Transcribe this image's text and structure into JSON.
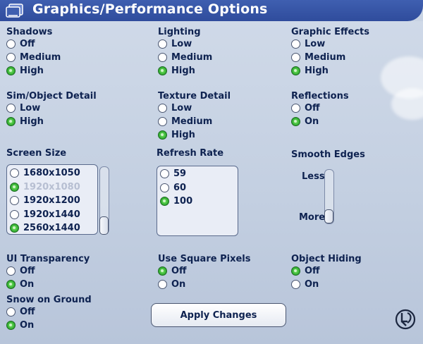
{
  "window": {
    "title": "Graphics/Performance Options"
  },
  "groups": {
    "shadows": {
      "label": "Shadows",
      "options": [
        "Off",
        "Medium",
        "High"
      ],
      "selected": "High"
    },
    "lighting": {
      "label": "Lighting",
      "options": [
        "Low",
        "Medium",
        "High"
      ],
      "selected": "High"
    },
    "graphic_effects": {
      "label": "Graphic Effects",
      "options": [
        "Low",
        "Medium",
        "High"
      ],
      "selected": "High"
    },
    "sim_detail": {
      "label": "Sim/Object Detail",
      "options": [
        "Low",
        "High"
      ],
      "selected": "High"
    },
    "texture_detail": {
      "label": "Texture Detail",
      "options": [
        "Low",
        "Medium",
        "High"
      ],
      "selected": "High"
    },
    "reflections": {
      "label": "Reflections",
      "options": [
        "Off",
        "On"
      ],
      "selected": "On"
    },
    "ui_transparency": {
      "label": "UI Transparency",
      "options": [
        "Off",
        "On"
      ],
      "selected": "On"
    },
    "square_pixels": {
      "label": "Use Square Pixels",
      "options": [
        "Off",
        "On"
      ],
      "selected": "Off"
    },
    "object_hiding": {
      "label": "Object Hiding",
      "options": [
        "Off",
        "On"
      ],
      "selected": "Off"
    },
    "snow": {
      "label": "Snow on Ground",
      "options": [
        "Off",
        "On"
      ],
      "selected": "On"
    }
  },
  "screen_size": {
    "label": "Screen Size",
    "items": [
      {
        "text": "1680x1050",
        "checked": false,
        "disabled": false
      },
      {
        "text": "1920x1080",
        "checked": true,
        "disabled": true
      },
      {
        "text": "1920x1200",
        "checked": false,
        "disabled": false
      },
      {
        "text": "1920x1440",
        "checked": false,
        "disabled": false
      },
      {
        "text": "2560x1440",
        "checked": true,
        "disabled": false
      }
    ]
  },
  "refresh_rate": {
    "label": "Refresh Rate",
    "items": [
      {
        "text": "59",
        "checked": false
      },
      {
        "text": "60",
        "checked": false
      },
      {
        "text": "100",
        "checked": true
      }
    ]
  },
  "smooth_edges": {
    "label": "Smooth Edges",
    "low_label": "Less",
    "high_label": "More",
    "level": 1.0
  },
  "apply_button": {
    "label": "Apply Changes"
  },
  "icons": {
    "title_logo": "sims-logo-icon",
    "back": "back-arrow-icon"
  },
  "colors": {
    "accent": "#2f4c9c",
    "selected": "#2ea82f",
    "text": "#0e2250"
  }
}
